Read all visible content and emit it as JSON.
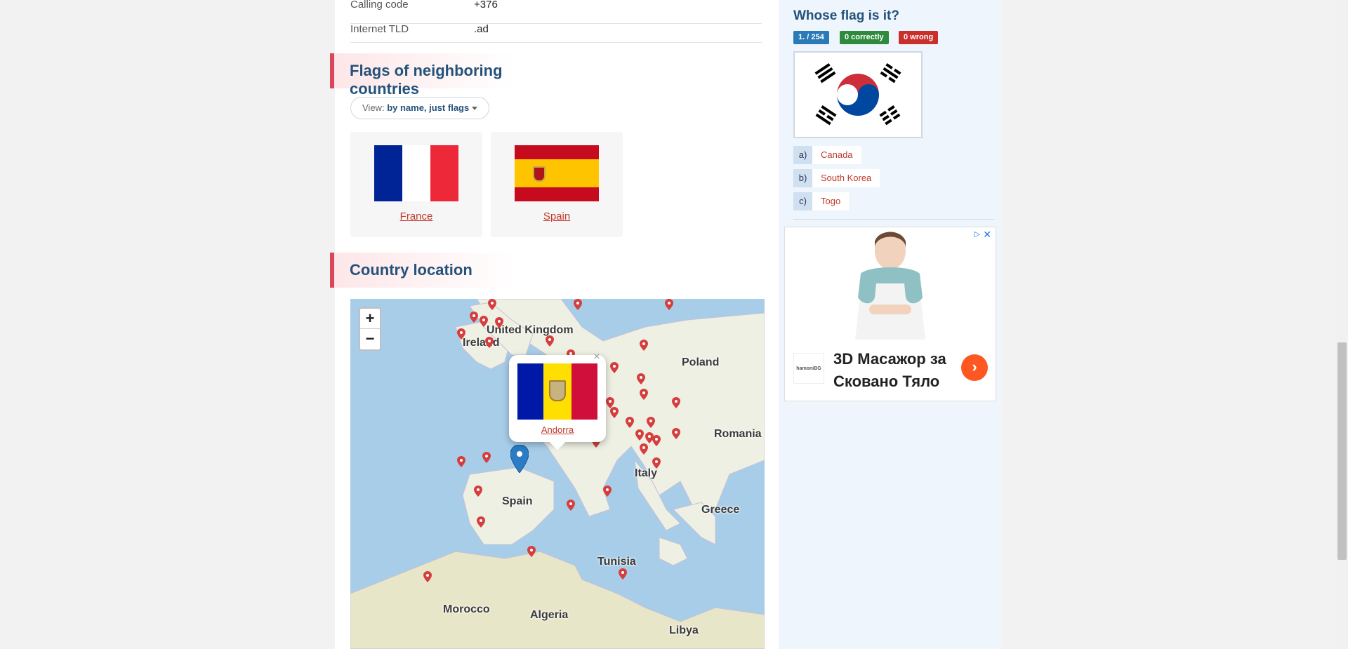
{
  "info": {
    "calling_code_label": "Calling code",
    "calling_code_value": "+376",
    "tld_label": "Internet TLD",
    "tld_value": ".ad"
  },
  "neighbors": {
    "title": "Flags of neighboring countries",
    "view_label": "View:",
    "view_value": "by name, just flags",
    "countries": [
      {
        "name": "France"
      },
      {
        "name": "Spain"
      }
    ]
  },
  "location": {
    "title": "Country location",
    "zoom_in": "+",
    "zoom_out": "−",
    "popup_country": "Andorra",
    "popup_close": "×",
    "labels": [
      {
        "text": "United Kingdom"
      },
      {
        "text": "Ireland"
      },
      {
        "text": "Poland"
      },
      {
        "text": "Romania"
      },
      {
        "text": "Italy"
      },
      {
        "text": "Spain"
      },
      {
        "text": "Greece"
      },
      {
        "text": "Tunisia"
      },
      {
        "text": "Morocco"
      },
      {
        "text": "Algeria"
      },
      {
        "text": "Libya"
      }
    ]
  },
  "quiz": {
    "title": "Whose flag is it?",
    "progress": "1. / 254",
    "correct": "0 correctly",
    "wrong": "0 wrong",
    "answers": [
      {
        "letter": "a)",
        "text": "Canada"
      },
      {
        "letter": "b)",
        "text": "South Korea"
      },
      {
        "letter": "c)",
        "text": "Togo"
      }
    ]
  },
  "ad": {
    "headline": "3D Масажор за Сковано Тяло",
    "logo_text": "hamoniBG",
    "go": "›",
    "close": "✕",
    "info": "▷"
  },
  "colors": {
    "accent_blue": "#24527a",
    "link_red": "#c0392b",
    "badge_blue": "#2a7ab8",
    "badge_green": "#2e8b3d",
    "badge_red": "#c9302c"
  }
}
